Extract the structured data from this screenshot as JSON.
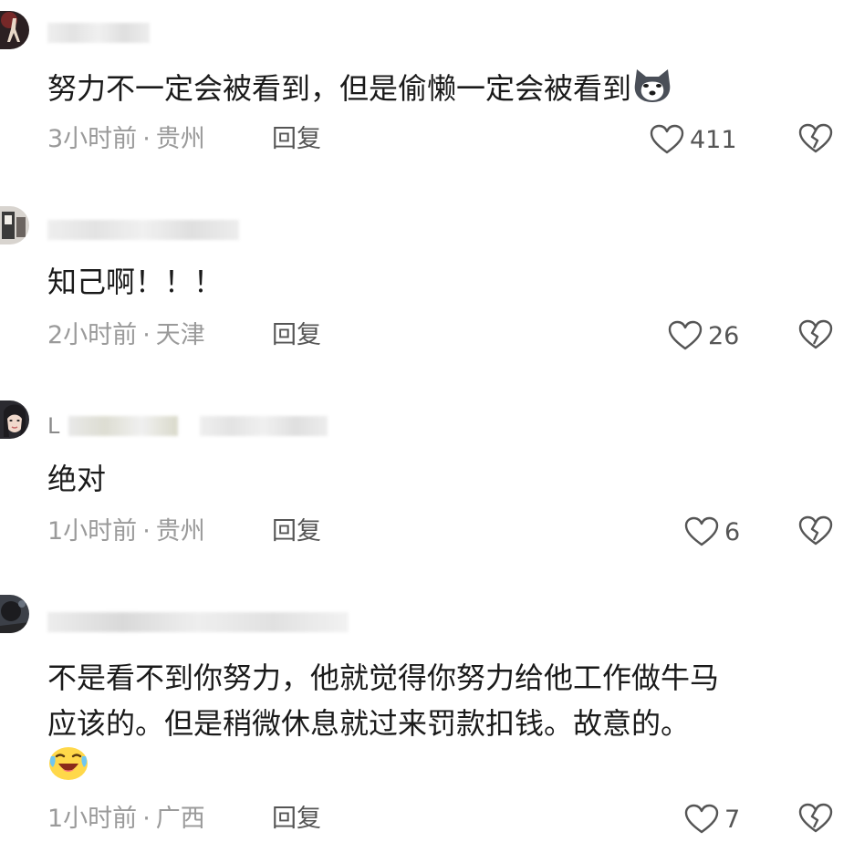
{
  "comments": [
    {
      "username": "",
      "content": "努力不一定会被看到，但是偷懒一定会被看到",
      "has_husky_emoji": true,
      "time": "3小时前",
      "location": "贵州",
      "reply_label": "回复",
      "likes": "411"
    },
    {
      "username": "",
      "content": "知己啊！！！",
      "time": "2小时前",
      "location": "天津",
      "reply_label": "回复",
      "likes": "26"
    },
    {
      "username": "L",
      "content": "绝对",
      "time": "1小时前",
      "location": "贵州",
      "reply_label": "回复",
      "likes": "6"
    },
    {
      "username": "",
      "content_line1": "不是看不到你努力，他就觉得你努力给他工作做牛马",
      "content_line2": "应该的。但是稍微休息就过来罚款扣钱。故意的。",
      "has_laugh_cry_emoji": true,
      "time": "1小时前",
      "location": "广西",
      "reply_label": "回复",
      "likes": "7"
    }
  ],
  "separator": "·",
  "icons": {
    "like": "heart-outline-icon",
    "dislike": "broken-heart-icon"
  }
}
